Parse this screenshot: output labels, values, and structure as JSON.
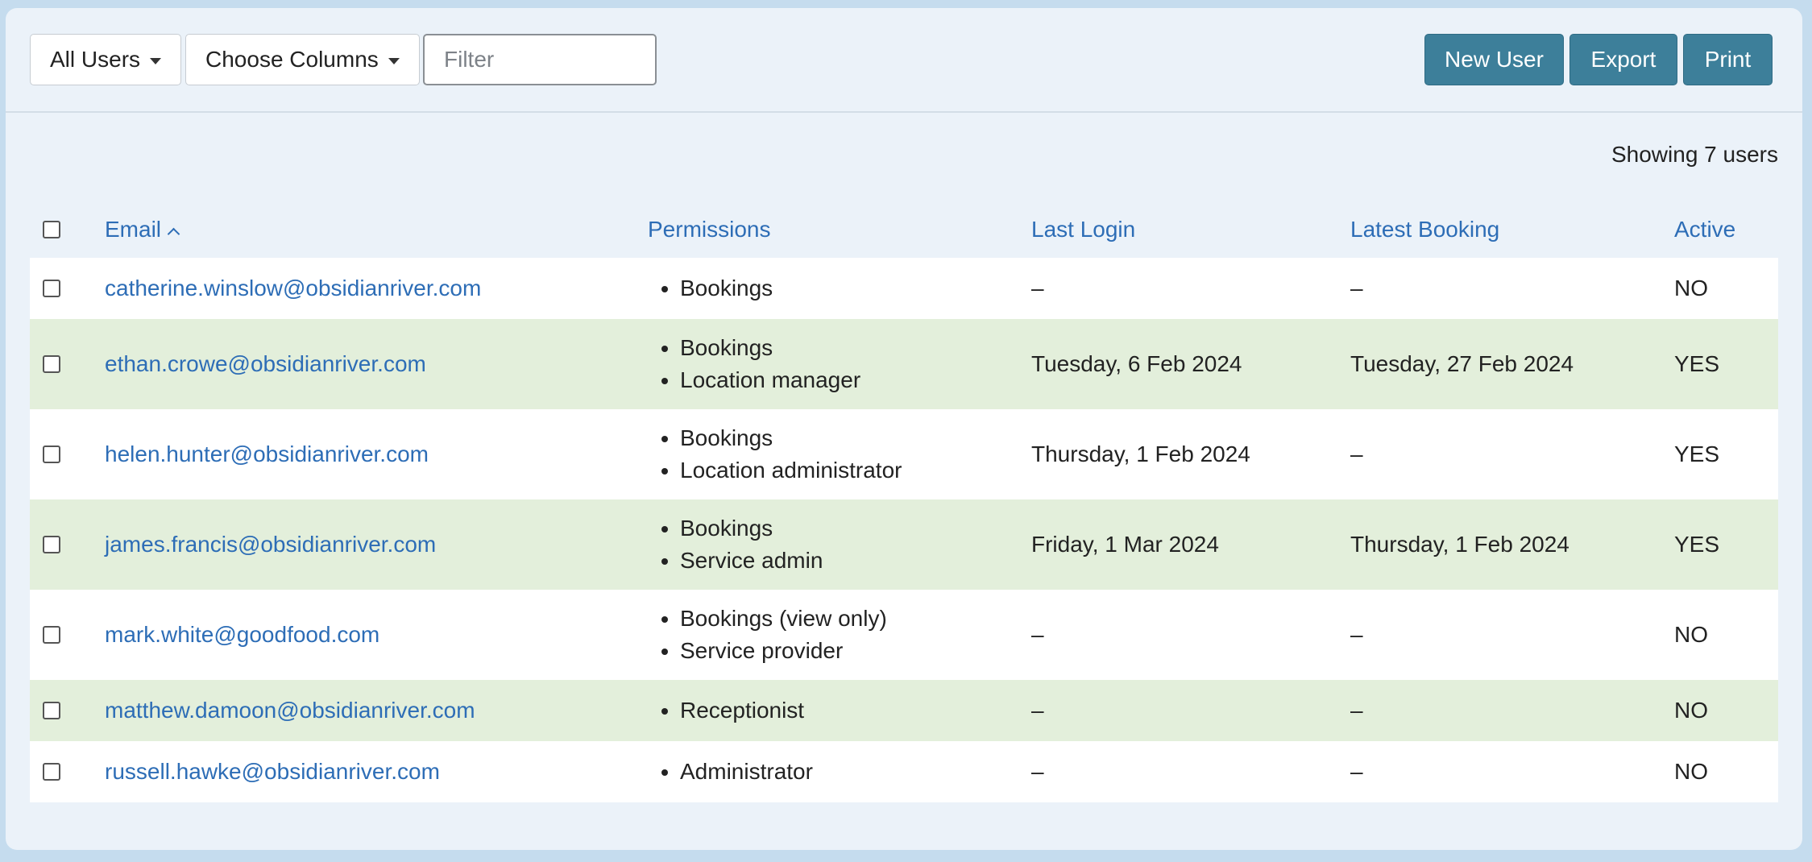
{
  "toolbar": {
    "user_filter": "All Users",
    "columns_menu": "Choose Columns",
    "filter_placeholder": "Filter",
    "filter_value": "",
    "new_user": "New User",
    "export": "Export",
    "print": "Print"
  },
  "summary": "Showing 7 users",
  "columns": {
    "email": "Email",
    "permissions": "Permissions",
    "last_login": "Last Login",
    "latest_booking": "Latest Booking",
    "active": "Active"
  },
  "sort": {
    "column": "Email",
    "direction": "ascending"
  },
  "users": [
    {
      "email": "catherine.winslow@obsidianriver.com",
      "permissions": [
        "Bookings"
      ],
      "last_login": "–",
      "latest_booking": "–",
      "active": "NO"
    },
    {
      "email": "ethan.crowe@obsidianriver.com",
      "permissions": [
        "Bookings",
        "Location manager"
      ],
      "last_login": "Tuesday, 6 Feb 2024",
      "latest_booking": "Tuesday, 27 Feb 2024",
      "active": "YES"
    },
    {
      "email": "helen.hunter@obsidianriver.com",
      "permissions": [
        "Bookings",
        "Location administrator"
      ],
      "last_login": "Thursday, 1 Feb 2024",
      "latest_booking": "–",
      "active": "YES"
    },
    {
      "email": "james.francis@obsidianriver.com",
      "permissions": [
        "Bookings",
        "Service admin"
      ],
      "last_login": "Friday, 1 Mar 2024",
      "latest_booking": "Thursday, 1 Feb 2024",
      "active": "YES"
    },
    {
      "email": "mark.white@goodfood.com",
      "permissions": [
        "Bookings (view only)",
        "Service provider"
      ],
      "last_login": "–",
      "latest_booking": "–",
      "active": "NO"
    },
    {
      "email": "matthew.damoon@obsidianriver.com",
      "permissions": [
        "Receptionist"
      ],
      "last_login": "–",
      "latest_booking": "–",
      "active": "NO"
    },
    {
      "email": "russell.hawke@obsidianriver.com",
      "permissions": [
        "Administrator"
      ],
      "last_login": "–",
      "latest_booking": "–",
      "active": "NO"
    }
  ],
  "colors": {
    "page_background": "#c5dcee",
    "panel_background": "#ebf2f9",
    "header_text": "#2d6db6",
    "primary_button": "#3d7f9a",
    "alt_row": "#e3efdb"
  }
}
